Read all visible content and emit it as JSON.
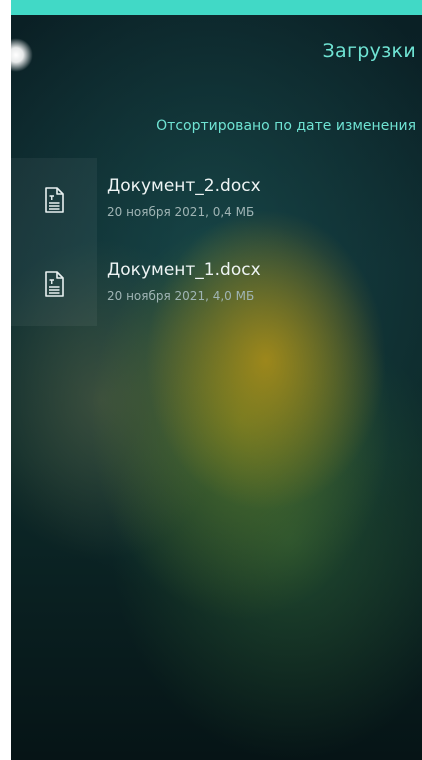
{
  "header": {
    "title": "Загрузки",
    "sort_label": "Отсортировано по дате изменения"
  },
  "files": [
    {
      "name": "Документ_2.docx",
      "meta": "20 ноября 2021, 0,4 МБ",
      "icon": "document-icon"
    },
    {
      "name": "Документ_1.docx",
      "meta": "20 ноября 2021, 4,0 МБ",
      "icon": "document-icon"
    }
  ],
  "colors": {
    "accent": "#41d9c6",
    "title_text": "#6fe3d3",
    "file_name": "#eef4f4",
    "file_meta": "#9fb4b4"
  }
}
